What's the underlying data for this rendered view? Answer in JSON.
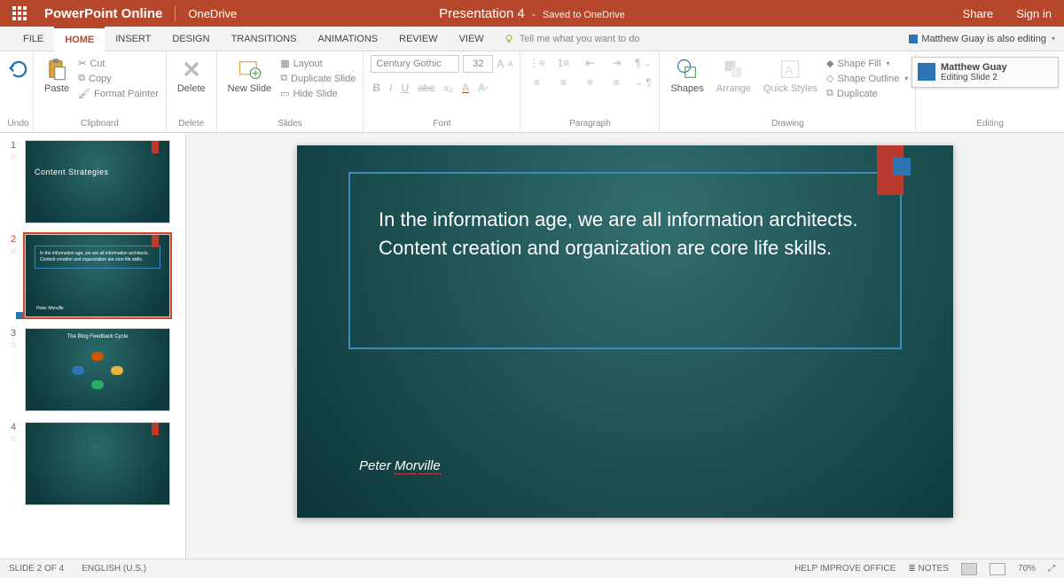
{
  "title": {
    "app": "PowerPoint Online",
    "drive": "OneDrive",
    "file": "Presentation 4",
    "status": "Saved to OneDrive",
    "share": "Share",
    "signin": "Sign in"
  },
  "tabs": [
    "FILE",
    "HOME",
    "INSERT",
    "DESIGN",
    "TRANSITIONS",
    "ANIMATIONS",
    "REVIEW",
    "VIEW"
  ],
  "active_tab": "HOME",
  "tellme": "Tell me what you want to do",
  "editing_badge": "Matthew Guay is also editing",
  "collab": {
    "name": "Matthew Guay",
    "status": "Editing Slide 2"
  },
  "ribbon": {
    "undo_group": "Undo",
    "clipboard": {
      "paste": "Paste",
      "cut": "Cut",
      "copy": "Copy",
      "fmt": "Format Painter",
      "group": "Clipboard"
    },
    "delete": {
      "btn": "Delete",
      "group": "Delete"
    },
    "slides": {
      "new": "New Slide",
      "layout": "Layout",
      "dup": "Duplicate Slide",
      "hide": "Hide Slide",
      "group": "Slides"
    },
    "font": {
      "name": "Century Gothic",
      "size": "32",
      "group": "Font"
    },
    "paragraph": {
      "group": "Paragraph"
    },
    "drawing": {
      "shapes": "Shapes",
      "arrange": "Arrange",
      "quick": "Quick Styles",
      "fill": "Shape Fill",
      "outline": "Shape Outline",
      "dup": "Duplicate",
      "group": "Drawing"
    },
    "editing": {
      "group": "Editing"
    }
  },
  "thumbs": [
    {
      "n": "1",
      "title": "Content Strategies"
    },
    {
      "n": "2",
      "quote": "In the information age, we are all information architects. Content creation and organization are core life skills.",
      "attr": "Peter Morville"
    },
    {
      "n": "3",
      "title": "The Blog Feedback Cycle"
    },
    {
      "n": "4",
      "title": ""
    }
  ],
  "slide": {
    "quote": "In the information age, we are all information architects. Content creation and organization are core life skills.",
    "attr_first": "Peter ",
    "attr_last": "Morville"
  },
  "status": {
    "left": "SLIDE 2 OF 4",
    "lang": "ENGLISH (U.S.)",
    "help": "HELP IMPROVE OFFICE",
    "notes": "NOTES",
    "zoom": "70%"
  }
}
